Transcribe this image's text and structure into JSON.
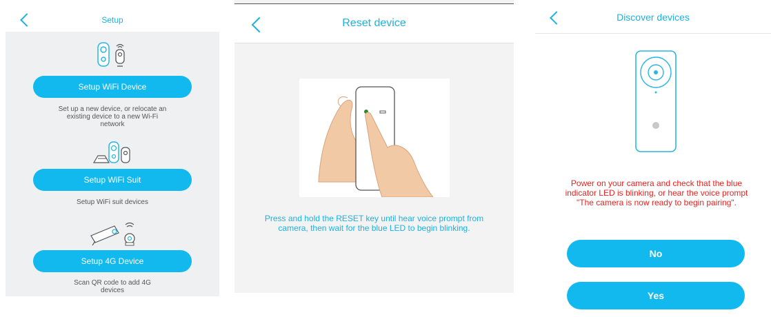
{
  "setup": {
    "title": "Setup",
    "wifi_button": "Setup WiFi Device",
    "wifi_desc": "Set up a new device, or relocate an existing device to a new Wi-Fi network",
    "suit_button": "Setup WiFi Suit",
    "suit_desc": "Setup WiFi suit devices",
    "g4_button": "Setup 4G Device",
    "g4_desc": "Scan QR code to add 4G devices"
  },
  "reset": {
    "title": "Reset device",
    "instructions": "Press and hold the RESET key until hear voice prompt from camera, then wait for the blue LED to begin blinking."
  },
  "discover": {
    "title": "Discover devices",
    "message": "Power on your camera and check that the blue indicator LED is blinking, or hear the voice prompt \"The camera is now ready to begin pairing\".",
    "no_button": "No",
    "yes_button": "Yes"
  },
  "colors": {
    "accent": "#11b9ef",
    "title": "#1cb1e0",
    "warning_text": "#e8231f",
    "panel_background": "#eff0f2"
  }
}
